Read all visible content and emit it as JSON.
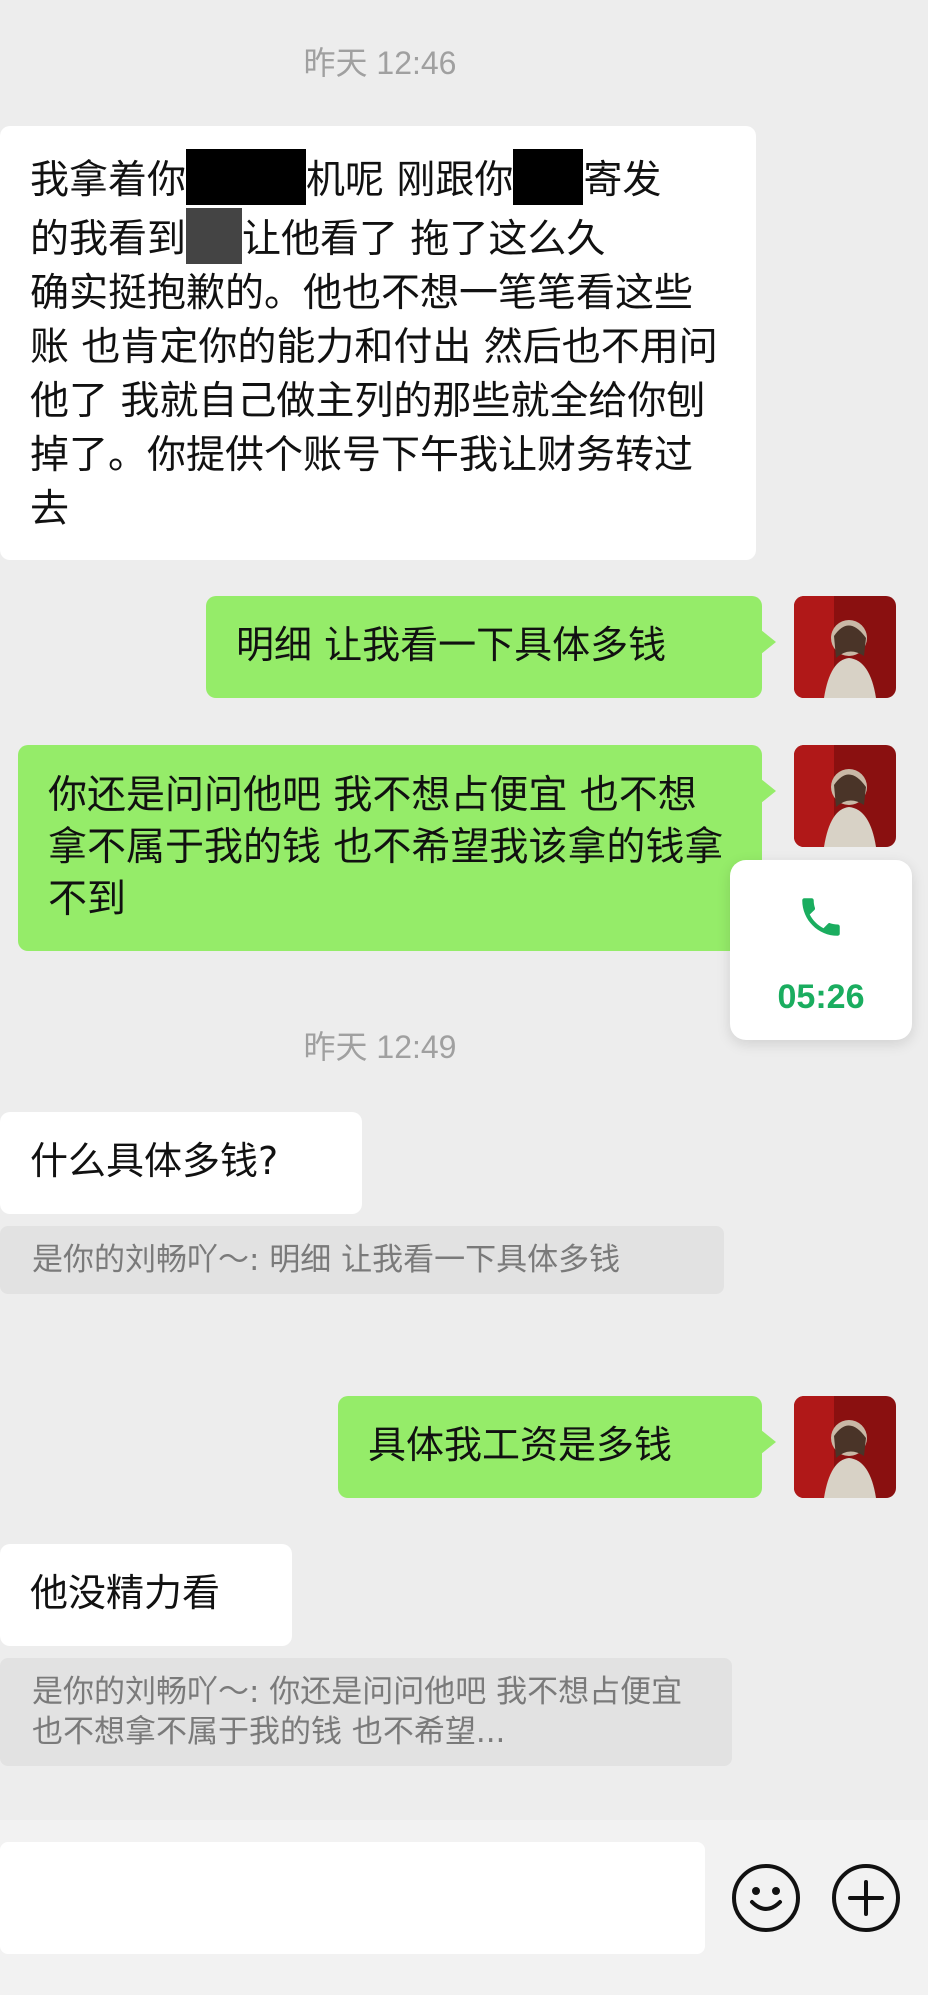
{
  "timestamps": [
    "昨天 12:46",
    "昨天 12:49"
  ],
  "messages": {
    "m1": {
      "line1_a": "我拿着你",
      "line1_b": "机呢 刚跟你",
      "line1_c": "寄发",
      "line2_a": "的我看到",
      "line2_b": "让他看了 拖了这么久",
      "rest": "确实挺抱歉的。他也不想一笔笔看这些账 也肯定你的能力和付出 然后也不用问他了 我就自己做主列的那些就全给你刨掉了。你提供个账号下午我让财务转过去"
    },
    "m2": "明细 让我看一下具体多钱",
    "m3": "你还是问问他吧 我不想占便宜 也不想拿不属于我的钱 也不希望我该拿的钱拿不到",
    "m4": "什么具体多钱?",
    "q4": "是你的刘畅吖～: 明细 让我看一下具体多钱",
    "m5": "具体我工资是多钱",
    "m6": "他没精力看",
    "q6": "是你的刘畅吖～: 你还是问问他吧 我不想占便宜 也不想拿不属于我的钱 也不希望..."
  },
  "call": {
    "duration": "05:26",
    "icon": "phone-icon"
  },
  "input_bar": {
    "emoji_icon": "emoji-icon",
    "plus_icon": "plus-icon"
  },
  "colors": {
    "outgoing_bubble": "#95ec69",
    "incoming_bubble": "#ffffff",
    "background": "#ededed",
    "call_accent": "#1aad5f"
  }
}
